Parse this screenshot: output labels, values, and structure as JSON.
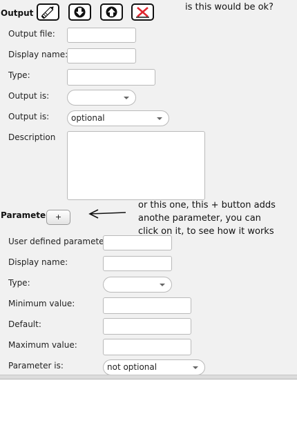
{
  "output": {
    "title": "Output",
    "toolbar": [
      {
        "icon": "pencil-icon"
      },
      {
        "icon": "arrow-down-icon"
      },
      {
        "icon": "arrow-up-icon"
      },
      {
        "icon": "delete-x-icon",
        "accent": "#e0262e"
      }
    ],
    "output_file_label": "Output file:",
    "output_file_value": "",
    "display_name_label": "Display name:",
    "display_name_value": "",
    "type_label": "Type:",
    "type_value": "",
    "output_is_1_label": "Output is:",
    "output_is_1_value": "",
    "output_is_2_label": "Output is:",
    "output_is_2_value": "optional",
    "description_label": "Description",
    "description_value": ""
  },
  "parameter": {
    "title": "Parameter",
    "add_button_label": "+",
    "user_defined_label": "User defined parameter",
    "user_defined_value": "",
    "display_name_label": "Display name:",
    "display_name_value": "",
    "type_label": "Type:",
    "type_value": "",
    "minimum_label": "Minimum value:",
    "minimum_value": "",
    "default_label": "Default:",
    "default_value": "",
    "maximum_label": "Maximum value:",
    "maximum_value": "",
    "parameter_is_label": "Parameter is:",
    "parameter_is_value": "not optional"
  },
  "annotations": {
    "note_top": "is this would be ok?",
    "note_middle_line1": "or this one, this + button adds",
    "note_middle_line2": "anothe parameter, you can",
    "note_middle_line3": "click on it, to see how it works"
  },
  "colors": {
    "background": "#f1f1f1",
    "field_border": "#b9b9b9",
    "delete_accent": "#e0262e"
  }
}
